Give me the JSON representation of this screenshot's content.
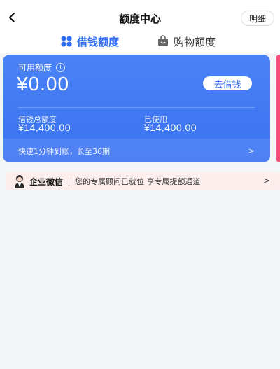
{
  "header": {
    "title": "额度中心",
    "detail_label": "明细"
  },
  "tabs": [
    {
      "label": "借钱额度",
      "active": true,
      "icon": "clover-icon"
    },
    {
      "label": "购物额度",
      "active": false,
      "icon": "bag-icon"
    }
  ],
  "card": {
    "available_label": "可用额度",
    "available_amount": "¥0.00",
    "borrow_button": "去借钱",
    "total_label": "借钱总额度",
    "total_value": "¥14,400.00",
    "used_label": "已使用",
    "used_value": "¥14,400.00",
    "promo": "快速1分钟到账，长至36期",
    "info_icon": "i"
  },
  "banner": {
    "name": "企业微信",
    "message": "您的专属顾问已就位 享专属提额通道"
  },
  "colors": {
    "accent": "#2f6df5",
    "card": "#4a82f6",
    "banner_bg": "#fdeeee"
  }
}
